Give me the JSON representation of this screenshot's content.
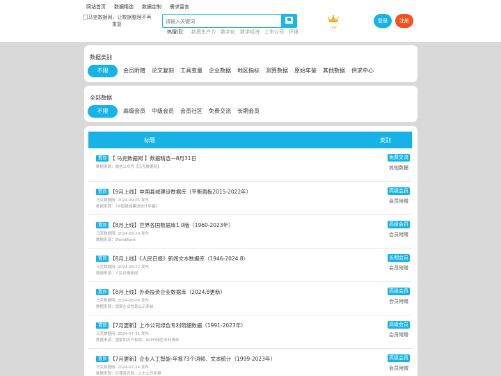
{
  "topnav": [
    "网站首页",
    "数据精选",
    "数据定制",
    "需求留言"
  ],
  "logo": {
    "alt": "马克数据网，让数据整理不再重复"
  },
  "search": {
    "placeholder": "请输入关键词"
  },
  "hot": {
    "label": "热搜词：",
    "items": [
      "新质生产力",
      "数字化",
      "数字经济",
      "上市公司",
      "环境"
    ]
  },
  "vip": {
    "label": "VIP"
  },
  "auth": {
    "login": "登录",
    "register": "注册"
  },
  "category_filter": {
    "title": "数据类别",
    "options": [
      "不限",
      "会员附赠",
      "论文复刻",
      "工具变量",
      "企业数据",
      "地区指标",
      "测算数据",
      "原始年鉴",
      "其他数据",
      "供求中心"
    ],
    "active": "不限"
  },
  "all_filter": {
    "title": "全部数据",
    "options": [
      "不限",
      "高级会员",
      "中级会员",
      "会员社区",
      "免费交流",
      "长期会员"
    ],
    "active": "不限"
  },
  "table": {
    "headers": {
      "title": "标题",
      "category": "类别"
    },
    "rows": [
      {
        "tag": "置顶",
        "title": "【 马克数据网 】数据精选—8月31日",
        "meta1": "数据来源：微信公众号【马克数据网】",
        "meta2": "",
        "badge": "免费交流",
        "category": "其他数据"
      },
      {
        "tag": "置顶",
        "title": "【9月上线】中国县域建设数据库（平衡面板2015-2022年）",
        "meta1": "马克数据网: 2024-09-05 发布",
        "meta2": "数据来源：《中国县城建设统计年鉴》",
        "badge": "高级会员",
        "category": "会员附赠"
      },
      {
        "tag": "置顶",
        "title": "【8月上线】世界各国数据库1.0版（1960-2023年）",
        "meta1": "马克数据网: 2024-08-29 发布",
        "meta2": "数据来源：WorldBank",
        "badge": "高级会员",
        "category": "会员附赠"
      },
      {
        "tag": "置顶",
        "title": "【8月上线】《人民日报》新闻文本数据库（1946-2024.8）",
        "meta1": "马克数据网: 2024-08-22 发布",
        "meta2": "数据来源：人民日报新闻",
        "badge": "长期会员",
        "category": "会员附赠"
      },
      {
        "tag": "置顶",
        "title": "【8月上线】外商投资企业数据库（2024.8更新）",
        "meta1": "马克数据网: 2024-08-06 发布",
        "meta2": "数据来源：国家企业信息公示系统",
        "badge": "高级会员",
        "category": "会员附赠"
      },
      {
        "tag": "置顶",
        "title": "【7月更新】上市公司绿色专利明细数据（1991-2023年）",
        "meta1": "马克数据网: 2024-07-31 发布",
        "meta2": "数据来源：国家知识产权局、WIPO绿色专利清单",
        "badge": "高级会员",
        "category": "会员附赠"
      },
      {
        "tag": "置顶",
        "title": "【7月更新】企业人工智能-年报73个词频、文本统计（1999-2023年）",
        "meta1": "马克数据网: 2024-07-24 发布",
        "meta2": "数据来源：巨潮资讯网、上市公司年报",
        "badge": "高级会员",
        "category": "会员附赠"
      }
    ]
  },
  "colors": {
    "accent": "#17b3e6",
    "register": "#f0531f",
    "vip": "#e8a91b",
    "background": "#d9d9d9"
  }
}
